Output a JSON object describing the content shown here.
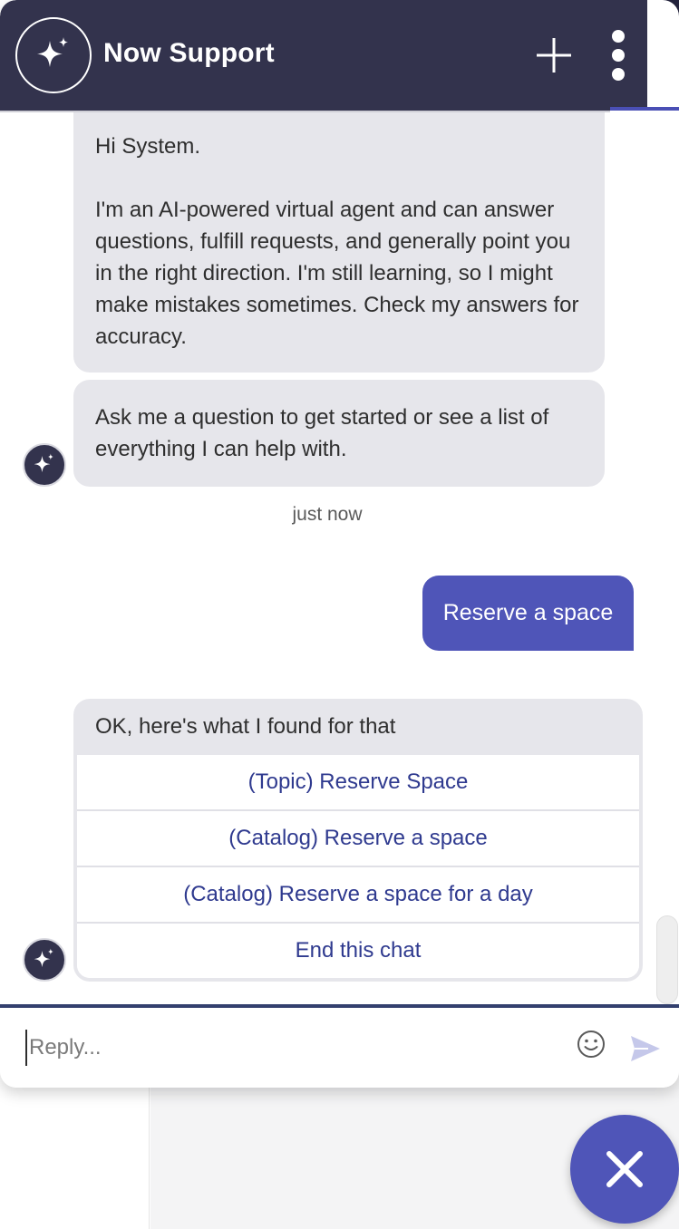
{
  "header": {
    "title": "Now Support",
    "logo_icon": "sparkle-icon",
    "new_chat_icon": "plus-icon",
    "more_icon": "more-vertical-icon",
    "background_color": "#33334d"
  },
  "messages": {
    "greeting": "Hi System.",
    "intro": "I'm an AI-powered virtual agent and can answer questions, fulfill requests, and generally point you in the right direction. I'm still learning, so I might make mistakes sometimes. Check my answers for accuracy.",
    "prompt": "Ask me a question to get started or see a list of everything I can help with.",
    "timestamp": "just now",
    "user_message": "Reserve a space",
    "results_title": "OK, here's what I found for that",
    "options": [
      "(Topic) Reserve Space",
      "(Catalog) Reserve a space",
      "(Catalog) Reserve a space for a day",
      "End this chat"
    ]
  },
  "composer": {
    "placeholder": "Reply...",
    "emoji_icon": "smiley-icon",
    "send_icon": "send-icon"
  },
  "fab": {
    "icon": "close-icon",
    "color": "#4f55b8"
  },
  "colors": {
    "accent": "#4f55b8",
    "bot_bubble": "#e6e6eb",
    "option_text": "#2f3a8f"
  }
}
